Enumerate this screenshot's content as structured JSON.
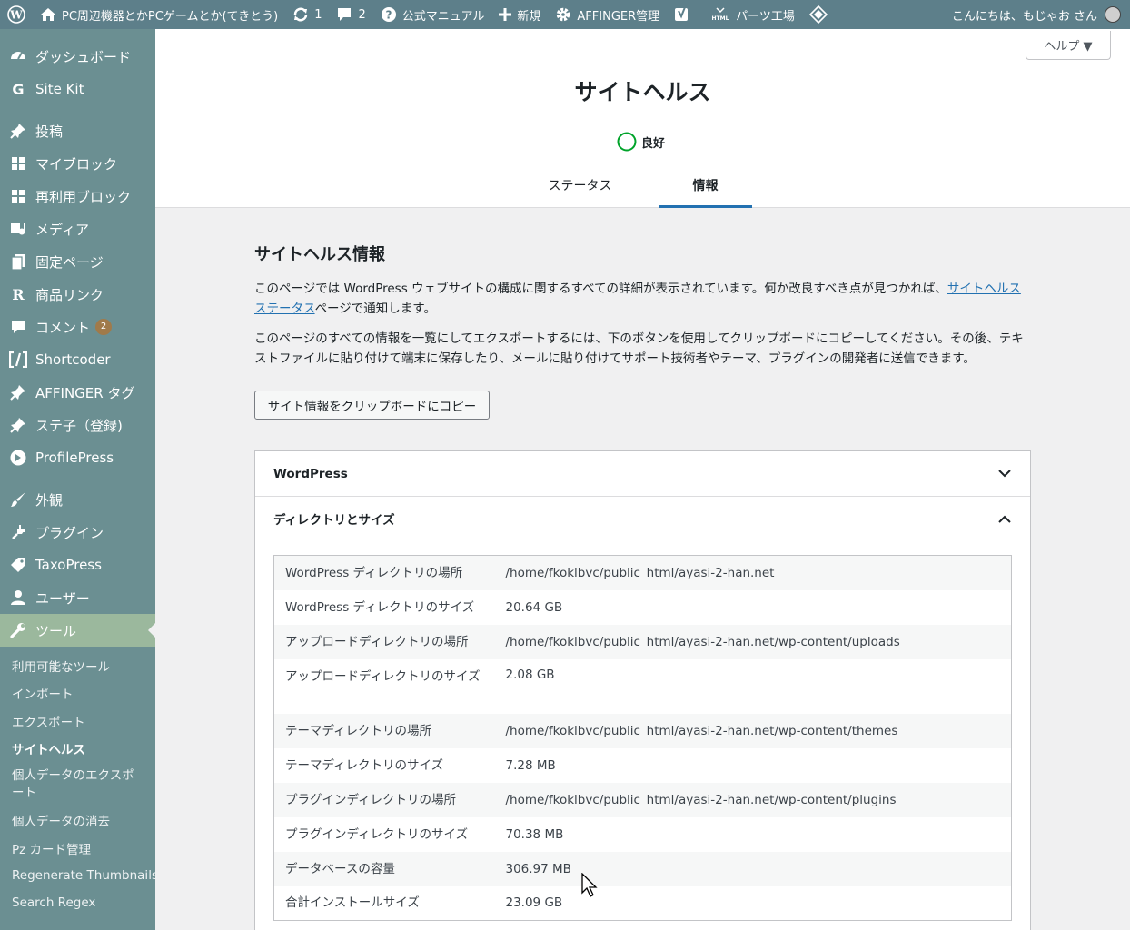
{
  "adminbar": {
    "site_name": "PC周辺機器とかPCゲームとか(てきとう)",
    "updates_count": "1",
    "comments_count": "2",
    "manual": "公式マニュアル",
    "new": "新規",
    "affinger": "AFFINGER管理",
    "parts": "パーツ工場",
    "greeting": "こんにちは、もじゃお さん"
  },
  "sidebar": {
    "dashboard": "ダッシュボード",
    "sitekit": "Site Kit",
    "posts": "投稿",
    "myblocks": "マイブロック",
    "reusable": "再利用ブロック",
    "media": "メディア",
    "pages": "固定ページ",
    "product_links": "商品リンク",
    "comments": "コメント",
    "comments_badge": "2",
    "shortcoder": "Shortcoder",
    "affinger_tag": "AFFINGER タグ",
    "steko": "ステ子（登録)",
    "profilepress": "ProfilePress",
    "appearance": "外観",
    "plugins": "プラグイン",
    "taxopress": "TaxoPress",
    "users": "ユーザー",
    "tools": "ツール",
    "sub": {
      "available": "利用可能なツール",
      "import": "インポート",
      "export": "エクスポート",
      "site_health": "サイトヘルス",
      "export_personal": "個人データのエクスポート",
      "erase_personal": "個人データの消去",
      "pz_card": "Pz カード管理",
      "regen": "Regenerate Thumbnails",
      "search_regex": "Search Regex"
    }
  },
  "header": {
    "help": "ヘルプ ▼",
    "title": "サイトヘルス",
    "score": "良好",
    "tab_status": "ステータス",
    "tab_info": "情報"
  },
  "main": {
    "title": "サイトヘルス情報",
    "desc1_before": "このページでは WordPress ウェブサイトの構成に関するすべての詳細が表示されています。何か改良すべき点が見つかれば、",
    "desc1_link": "サイトヘルスステータス",
    "desc1_after": "ページで通知します。",
    "desc2": "このページのすべての情報を一覧にしてエクスポートするには、下のボタンを使用してクリップボードにコピーしてください。その後、テキストファイルに貼り付けて端末に保存したり、メールに貼り付けてサポート技術者やテーマ、プラグインの開発者に送信できます。",
    "copy_button": "サイト情報をクリップボードにコピー",
    "acc_wordpress": "WordPress",
    "acc_directories": "ディレクトリとサイズ",
    "rows": [
      {
        "key": "WordPress ディレクトリの場所",
        "value": "/home/fkoklbvc/public_html/ayasi-2-han.net"
      },
      {
        "key": "WordPress ディレクトリのサイズ",
        "value": "20.64 GB"
      },
      {
        "key": "アップロードディレクトリの場所",
        "value": "/home/fkoklbvc/public_html/ayasi-2-han.net/wp-content/uploads"
      },
      {
        "key": "アップロードディレクトリのサイズ",
        "value": "2.08 GB"
      },
      {
        "key": "テーマディレクトリの場所",
        "value": "/home/fkoklbvc/public_html/ayasi-2-han.net/wp-content/themes"
      },
      {
        "key": "テーマディレクトリのサイズ",
        "value": "7.28 MB"
      },
      {
        "key": "プラグインディレクトリの場所",
        "value": "/home/fkoklbvc/public_html/ayasi-2-han.net/wp-content/plugins"
      },
      {
        "key": "プラグインディレクトリのサイズ",
        "value": "70.38 MB"
      },
      {
        "key": "データベースの容量",
        "value": "306.97 MB"
      },
      {
        "key": "合計インストールサイズ",
        "value": "23.09 GB"
      }
    ]
  },
  "colors": {
    "adminbar": "#5d7f8a",
    "sidebar": "#6b8f92",
    "sidebar_current": "#9bb89d",
    "accent": "#2271b1",
    "good": "#00a32a"
  }
}
